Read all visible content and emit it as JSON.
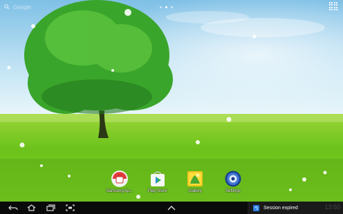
{
  "search": {
    "label": "Google"
  },
  "pages": {
    "count": 3,
    "active": 1
  },
  "dock": {
    "apps": [
      {
        "label": "Samsung Ap...",
        "icon": "samsung-apps-icon"
      },
      {
        "label": "Play Store",
        "icon": "play-store-icon"
      },
      {
        "label": "Gallery",
        "icon": "gallery-icon"
      },
      {
        "label": "Settings",
        "icon": "settings-icon"
      }
    ]
  },
  "navbar": {
    "buttons": [
      "back-icon",
      "home-icon",
      "recent-apps-icon",
      "screenshot-icon",
      "menu-up-icon"
    ]
  },
  "notification": {
    "text": "Session expired",
    "time": "13:50",
    "accent": "#2a7de1"
  },
  "colors": {
    "sky": "#a9d7ef",
    "grass": "#7fd02a",
    "tree": "#2f9a24"
  }
}
